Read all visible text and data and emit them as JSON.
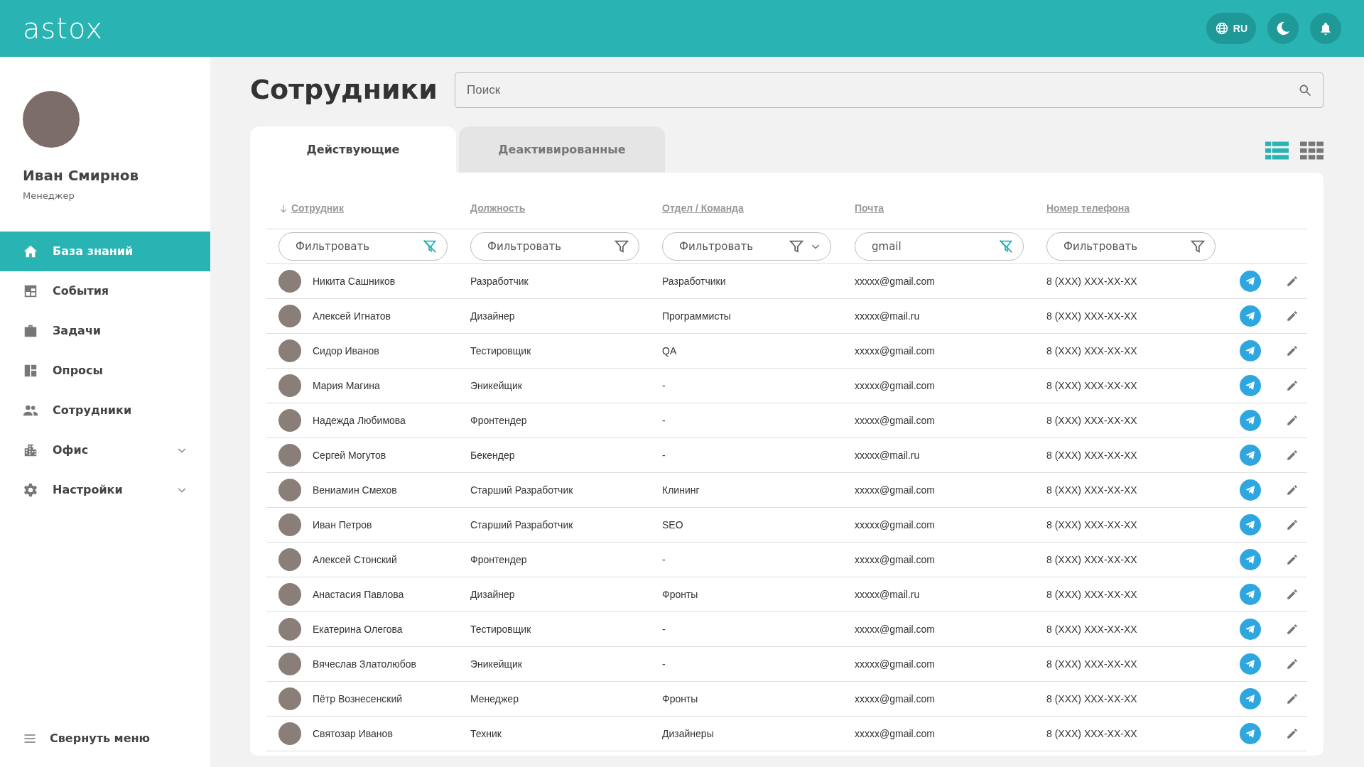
{
  "header": {
    "logo": "astox",
    "language": "RU"
  },
  "profile": {
    "name": "Иван Смирнов",
    "role": "Менеджер"
  },
  "sidebar": {
    "items": [
      {
        "label": "База знаний",
        "selected": true,
        "expandable": false
      },
      {
        "label": "События",
        "selected": false,
        "expandable": false
      },
      {
        "label": "Задачи",
        "selected": false,
        "expandable": false
      },
      {
        "label": "Опросы",
        "selected": false,
        "expandable": false
      },
      {
        "label": "Сотрудники",
        "selected": false,
        "expandable": false
      },
      {
        "label": "Офис",
        "selected": false,
        "expandable": true
      },
      {
        "label": "Настройки",
        "selected": false,
        "expandable": true
      }
    ],
    "collapse": "Свернуть меню"
  },
  "page": {
    "title": "Сотрудники",
    "search": {
      "placeholder": "Поиск"
    }
  },
  "tabs": [
    {
      "label": "Действующие",
      "selected": true
    },
    {
      "label": "Деактивированные",
      "selected": false
    }
  ],
  "views": [
    {
      "kind": "list",
      "selected": true
    },
    {
      "kind": "grid",
      "selected": false
    }
  ],
  "table": {
    "columns": [
      {
        "label": "Сотрудник",
        "sorted": true,
        "filter": {
          "placeholder": "Фильтровать",
          "active": true,
          "dropdown": false
        }
      },
      {
        "label": "Должность",
        "sorted": false,
        "filter": {
          "placeholder": "Фильтровать",
          "active": false,
          "dropdown": false
        }
      },
      {
        "label": "Отдел / Команда",
        "sorted": false,
        "filter": {
          "placeholder": "Фильтровать",
          "active": false,
          "dropdown": true
        }
      },
      {
        "label": "Почта",
        "sorted": false,
        "filter": {
          "value": "gmail",
          "active": true,
          "dropdown": false
        }
      },
      {
        "label": "Номер телефона",
        "sorted": false,
        "filter": {
          "placeholder": "Фильтровать",
          "active": false,
          "dropdown": false
        }
      }
    ],
    "rows": [
      [
        "Никита Сашников",
        "Разработчик",
        "Разработчики",
        "xxxxx@gmail.com",
        "8 (XXX) XXX-XX-XX"
      ],
      [
        "Алексей Игнатов",
        "Дизайнер",
        "Программисты",
        "xxxxx@mail.ru",
        "8 (XXX) XXX-XX-XX"
      ],
      [
        "Сидор Иванов",
        "Тестировщик",
        "QA",
        "xxxxx@gmail.com",
        "8 (XXX) XXX-XX-XX"
      ],
      [
        "Мария Магина",
        "Эникейщик",
        "-",
        "xxxxx@gmail.com",
        "8 (XXX) XXX-XX-XX"
      ],
      [
        "Надежда Любимова",
        "Фронтендер",
        "-",
        "xxxxx@gmail.com",
        "8 (XXX) XXX-XX-XX"
      ],
      [
        "Сергей Могутов",
        "Бекендер",
        "-",
        "xxxxx@mail.ru",
        "8 (XXX) XXX-XX-XX"
      ],
      [
        "Вениамин Смехов",
        "Старший Разработчик",
        "Клининг",
        "xxxxx@gmail.com",
        "8 (XXX) XXX-XX-XX"
      ],
      [
        "Иван Петров",
        "Старший Разработчик",
        "SEO",
        "xxxxx@gmail.com",
        "8 (XXX) XXX-XX-XX"
      ],
      [
        "Алексей Стонский",
        "Фронтендер",
        "-",
        "xxxxx@gmail.com",
        "8 (XXX) XXX-XX-XX"
      ],
      [
        "Анастасия Павлова",
        "Дизайнер",
        "Фронты",
        "xxxxx@mail.ru",
        "8 (XXX) XXX-XX-XX"
      ],
      [
        "Екатерина Олегова",
        "Тестировщик",
        "-",
        "xxxxx@gmail.com",
        "8 (XXX) XXX-XX-XX"
      ],
      [
        "Вячеслав Златолюбов",
        "Эникейщик",
        "-",
        "xxxxx@gmail.com",
        "8 (XXX) XXX-XX-XX"
      ],
      [
        "Пётр Вознесенский",
        "Менеджер",
        "Фронты",
        "xxxxx@gmail.com",
        "8 (XXX) XXX-XX-XX"
      ],
      [
        "Святозар Иванов",
        "Техник",
        "Дизайнеры",
        "xxxxx@gmail.com",
        "8 (XXX) XXX-XX-XX"
      ]
    ]
  }
}
